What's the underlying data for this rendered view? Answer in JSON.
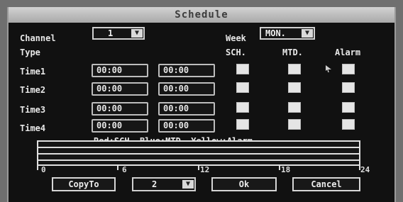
{
  "window": {
    "title": "Schedule"
  },
  "labels": {
    "channel": "Channel",
    "week": "Week",
    "type": "Type",
    "sch": "SCH.",
    "mtd": "MTD.",
    "alarm": "Alarm",
    "legend": "Red:SCH.  Blue:MTD.  Yellow:Alarm"
  },
  "channel": {
    "value": "1"
  },
  "week": {
    "value": "MON."
  },
  "times": [
    {
      "label": "Time1",
      "start": "00:00",
      "end": "00:00"
    },
    {
      "label": "Time2",
      "start": "00:00",
      "end": "00:00"
    },
    {
      "label": "Time3",
      "start": "00:00",
      "end": "00:00"
    },
    {
      "label": "Time4",
      "start": "00:00",
      "end": "00:00"
    }
  ],
  "timeline_axis": [
    "0",
    "6",
    "12",
    "18",
    "24"
  ],
  "buttons": {
    "copy_to": "CopyTo",
    "copy_channel": "2",
    "ok": "Ok",
    "cancel": "Cancel"
  },
  "icons": {
    "dropdown": "chevron-down-icon",
    "cursor": "mouse-pointer-icon"
  }
}
